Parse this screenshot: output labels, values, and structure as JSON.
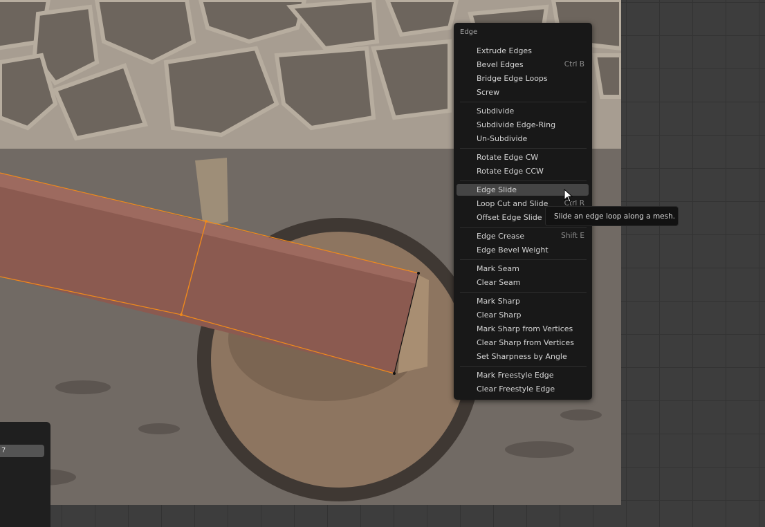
{
  "menu": {
    "title": "Edge",
    "items": [
      {
        "label": "Extrude Edges",
        "shortcut": ""
      },
      {
        "label": "Bevel Edges",
        "shortcut": "Ctrl B"
      },
      {
        "label": "Bridge Edge Loops",
        "shortcut": ""
      },
      {
        "label": "Screw",
        "shortcut": ""
      },
      {
        "label": "Subdivide",
        "shortcut": ""
      },
      {
        "label": "Subdivide Edge-Ring",
        "shortcut": ""
      },
      {
        "label": "Un-Subdivide",
        "shortcut": ""
      },
      {
        "label": "Rotate Edge CW",
        "shortcut": ""
      },
      {
        "label": "Rotate Edge CCW",
        "shortcut": ""
      },
      {
        "label": "Edge Slide",
        "shortcut": ""
      },
      {
        "label": "Loop Cut and Slide",
        "shortcut": "Ctrl R"
      },
      {
        "label": "Offset Edge Slide",
        "shortcut": ""
      },
      {
        "label": "Edge Crease",
        "shortcut": "Shift E"
      },
      {
        "label": "Edge Bevel Weight",
        "shortcut": ""
      },
      {
        "label": "Mark Seam",
        "shortcut": ""
      },
      {
        "label": "Clear Seam",
        "shortcut": ""
      },
      {
        "label": "Mark Sharp",
        "shortcut": ""
      },
      {
        "label": "Clear Sharp",
        "shortcut": ""
      },
      {
        "label": "Mark Sharp from Vertices",
        "shortcut": ""
      },
      {
        "label": "Clear Sharp from Vertices",
        "shortcut": ""
      },
      {
        "label": "Set Sharpness by Angle",
        "shortcut": ""
      },
      {
        "label": "Mark Freestyle Edge",
        "shortcut": ""
      },
      {
        "label": "Clear Freestyle Edge",
        "shortcut": ""
      }
    ]
  },
  "tooltip": {
    "text": "Slide an edge loop along a mesh."
  },
  "left_panel": {
    "field_value": "7"
  },
  "colors": {
    "selection_orange": "#f08a1c",
    "menu_bg": "#181818",
    "highlight": "#454545"
  }
}
